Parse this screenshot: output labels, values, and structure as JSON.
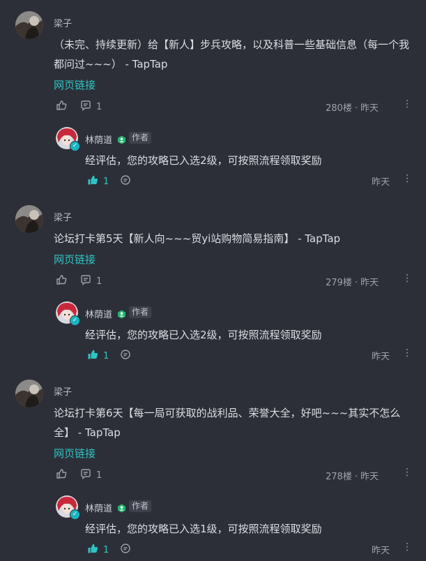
{
  "posts": [
    {
      "username": "梁子",
      "content": "（未完、持续更新）给【新人】步兵攻略，以及科普一些基础信息（每一个我都问过~~~） - TapTap",
      "link": "网页链接",
      "comment_count": "1",
      "floor": "280楼",
      "time": "昨天",
      "reply": {
        "name": "林荫道",
        "tag": "作者",
        "content": "经评估，您的攻略已入选2级，可按照流程领取奖励",
        "like_count": "1",
        "time": "昨天"
      }
    },
    {
      "username": "梁子",
      "content": "论坛打卡第5天【新人向~~~贸yi站购物简易指南】 - TapTap",
      "link": "网页链接",
      "comment_count": "1",
      "floor": "279楼",
      "time": "昨天",
      "reply": {
        "name": "林荫道",
        "tag": "作者",
        "content": "经评估，您的攻略已入选2级，可按照流程领取奖励",
        "like_count": "1",
        "time": "昨天"
      }
    },
    {
      "username": "梁子",
      "content": "论坛打卡第6天【每一局可获取的战利品、荣誉大全，好吧~~~其实不怎么全】 - TapTap",
      "link": "网页链接",
      "comment_count": "1",
      "floor": "278楼",
      "time": "昨天",
      "reply": {
        "name": "林荫道",
        "tag": "作者",
        "content": "经评估，您的攻略已入选1级，可按照流程领取奖励",
        "like_count": "1",
        "time": "昨天"
      }
    }
  ],
  "icons": {
    "like": "thumbs-up-icon",
    "comment": "comment-bubble-icon",
    "more": "more-vertical-icon",
    "verified": "verified-check-icon",
    "author_badge": "author-badge-icon"
  },
  "colors": {
    "background": "#2d2f38",
    "accent": "#2fc4c4",
    "text": "#dcdee4",
    "muted": "#9ea2ab"
  }
}
